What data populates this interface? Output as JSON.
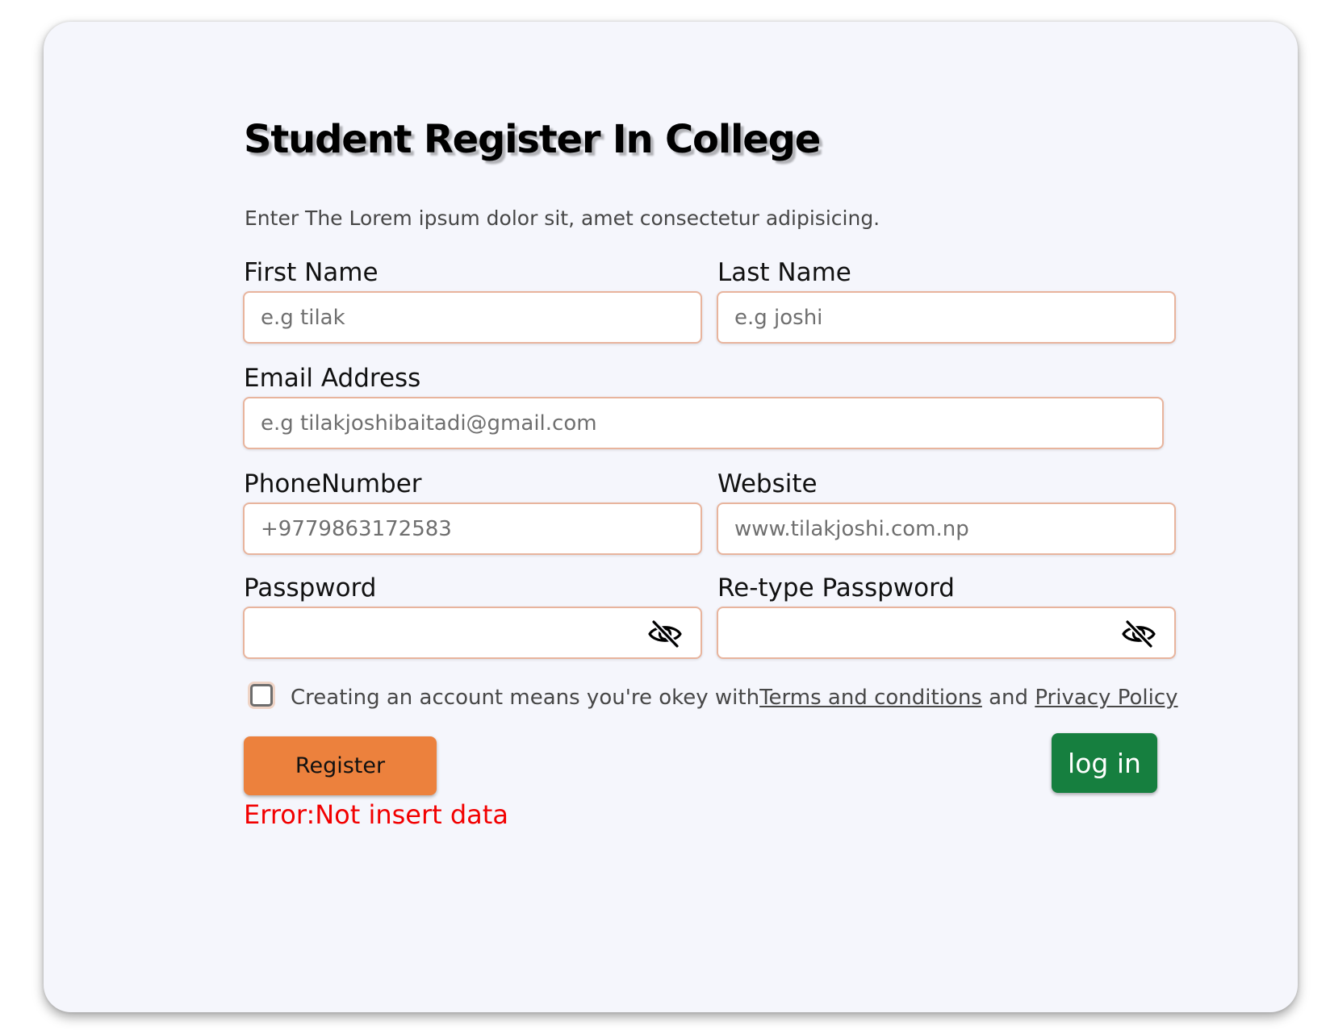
{
  "form": {
    "title": "Student Register In College",
    "subtitle": "Enter The Lorem ipsum dolor sit, amet consectetur adipisicing.",
    "first_name": {
      "label": "First Name",
      "placeholder": "e.g tilak",
      "value": ""
    },
    "last_name": {
      "label": "Last Name",
      "placeholder": "e.g joshi",
      "value": ""
    },
    "email": {
      "label": "Email Address",
      "placeholder": "e.g tilakjoshibaitadi@gmail.com",
      "value": ""
    },
    "phone": {
      "label": "PhoneNumber",
      "placeholder": "+9779863172583",
      "value": ""
    },
    "website": {
      "label": "Website",
      "placeholder": "www.tilakjoshi.com.np",
      "value": ""
    },
    "password": {
      "label": "Passpword",
      "value": "",
      "icon": "eye-slash-icon"
    },
    "retype_password": {
      "label": "Re-type Passpword",
      "value": "",
      "icon": "eye-slash-icon"
    },
    "terms": {
      "checked": false,
      "text": "Creating an account means you're okey with",
      "terms_link": "Terms and conditions",
      "joiner": " and ",
      "privacy_link": "Privacy Policy"
    },
    "register_label": "Register",
    "login_label": "log in",
    "error_message": "Error:Not insert data"
  },
  "colors": {
    "card_background": "#f5f6fc",
    "input_border": "#e8b49d",
    "register_button": "#ec813d",
    "login_button": "#167f3f",
    "error_text": "#f20000"
  }
}
